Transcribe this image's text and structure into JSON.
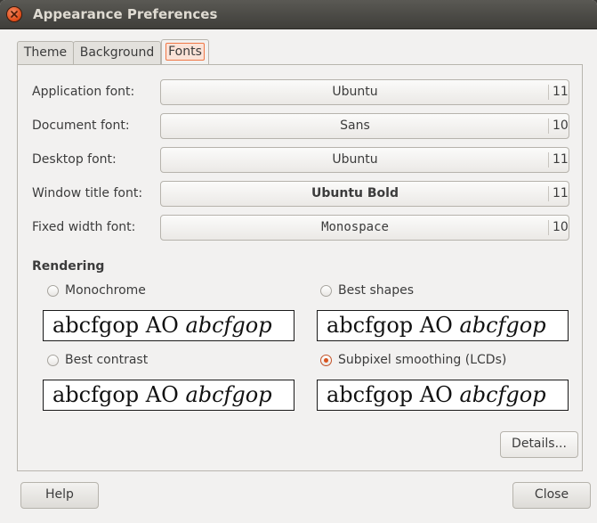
{
  "window": {
    "title": "Appearance Preferences"
  },
  "tabs": [
    {
      "label": "Theme",
      "active": false
    },
    {
      "label": "Background",
      "active": false
    },
    {
      "label": "Fonts",
      "active": true
    }
  ],
  "fonts": [
    {
      "label": "Application font:",
      "name": "Ubuntu",
      "size": "11"
    },
    {
      "label": "Document font:",
      "name": "Sans",
      "size": "10"
    },
    {
      "label": "Desktop font:",
      "name": "Ubuntu",
      "size": "11"
    },
    {
      "label": "Window title font:",
      "name": "Ubuntu Bold",
      "size": "11"
    },
    {
      "label": "Fixed width font:",
      "name": "Monospace",
      "size": "10"
    }
  ],
  "rendering": {
    "heading": "Rendering",
    "options": [
      {
        "label": "Monochrome",
        "selected": false,
        "sample_plain": "abcfgop AO ",
        "sample_italic": "abcfgop"
      },
      {
        "label": "Best shapes",
        "selected": false,
        "sample_plain": "abcfgop AO ",
        "sample_italic": "abcfgop"
      },
      {
        "label": "Best contrast",
        "selected": false,
        "sample_plain": "abcfgop AO ",
        "sample_italic": "abcfgop"
      },
      {
        "label": "Subpixel smoothing (LCDs)",
        "selected": true,
        "sample_plain": "abcfgop AO ",
        "sample_italic": "abcfgop"
      }
    ]
  },
  "buttons": {
    "details": "Details...",
    "help": "Help",
    "close": "Close"
  },
  "colors": {
    "accent": "#df4a16",
    "titlebar": "#3f3e3a",
    "window_bg": "#f2f1f0"
  }
}
